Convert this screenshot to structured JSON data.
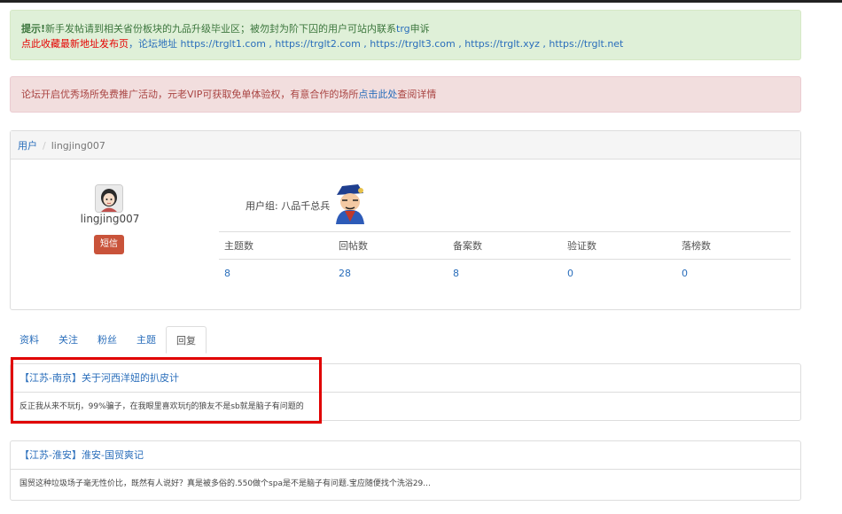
{
  "notice_green": {
    "line1_prefix": "提示!",
    "line1_text": "新手发帖请到相关省份板块的九品升级毕业区；被勿封为阶下囚的用户可站内联系",
    "line1_link": "trg",
    "line1_suffix": "申诉",
    "line2_link": "点此收藏最新地址发布页",
    "line2_text": "，论坛地址 https://trglt1.com , https://trglt2.com , https://trglt3.com , https://trglt.xyz , https://trglt.net"
  },
  "notice_red": {
    "text": "论坛开启优秀场所免费推广活动，元老VIP可获取免单体验权，有意合作的场所",
    "link": "点击此处",
    "suffix": "查阅详情"
  },
  "breadcrumb": {
    "root": "用户",
    "separator": "/",
    "current": "lingjing007"
  },
  "profile": {
    "username": "lingjing007",
    "pm_button": "短信",
    "group_label": "用户组: 八品千总兵",
    "avatar_icon": "user-avatar-icon",
    "group_icon": "rank-badge-icon"
  },
  "stats": {
    "headers": [
      "主题数",
      "回帖数",
      "备案数",
      "验证数",
      "落榜数"
    ],
    "values": [
      "8",
      "28",
      "8",
      "0",
      "0"
    ]
  },
  "tabs": [
    "资料",
    "关注",
    "粉丝",
    "主题",
    "回复"
  ],
  "active_tab": "回复",
  "posts": [
    {
      "title": "【江苏-南京】关于河西洋妞的扒皮计",
      "excerpt": "反正我从来不玩fj，99%骗子，在我眼里喜欢玩fj的狼友不是sb就是脑子有问题的"
    },
    {
      "title": "【江苏-淮安】淮安-国贸爽记",
      "excerpt": "国贸这种垃圾场子毫无性价比，既然有人说好？真是被多俗的.550做个spa是不是脑子有问题.宝应随便找个洗浴29..."
    }
  ],
  "colors": {
    "highlight": "#e00000",
    "link": "#2a6ebb",
    "pm_button": "#c9533a"
  }
}
